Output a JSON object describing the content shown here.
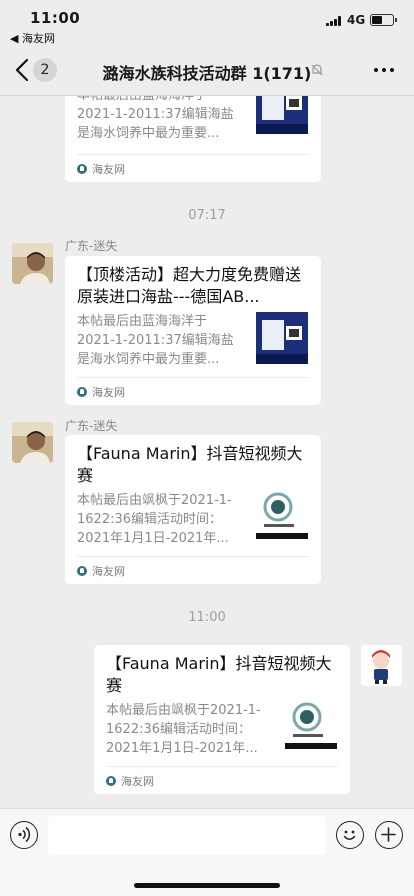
{
  "status": {
    "time": "11:00",
    "back_app": "◀ 海友网",
    "network": "4G",
    "battery_level": 0.55
  },
  "navbar": {
    "unread_count": "2",
    "title": "潞海水族科技活动群 1(171)"
  },
  "messages": [
    {
      "kind": "card",
      "side": "left",
      "title": "",
      "desc": "本帖最后由蓝海海洋于2021-1-2011:37编辑海盐是海水饲养中最为重要...",
      "source": "海友网"
    },
    {
      "kind": "timestamp",
      "text": "07:17"
    },
    {
      "kind": "card",
      "side": "left",
      "sender": "广东-迷失",
      "title": "【顶楼活动】超大力度免费赠送原装进口海盐---德国AB...",
      "desc": "本帖最后由蓝海海洋于2021-1-2011:37编辑海盐是海水饲养中最为重要...",
      "source": "海友网"
    },
    {
      "kind": "card",
      "side": "left",
      "sender": "广东-迷失",
      "title": "【Fauna Marin】抖音短视频大赛",
      "desc": "本帖最后由飒枫于2021-1-1622:36编辑活动时间：2021年1月1日-2021年...",
      "source": "海友网"
    },
    {
      "kind": "timestamp",
      "text": "11:00"
    },
    {
      "kind": "card",
      "side": "right",
      "title": "【Fauna Marin】抖音短视频大赛",
      "desc": "本帖最后由飒枫于2021-1-1622:36编辑活动时间：2021年1月1日-2021年...",
      "source": "海友网"
    }
  ],
  "input": {
    "placeholder": ""
  }
}
